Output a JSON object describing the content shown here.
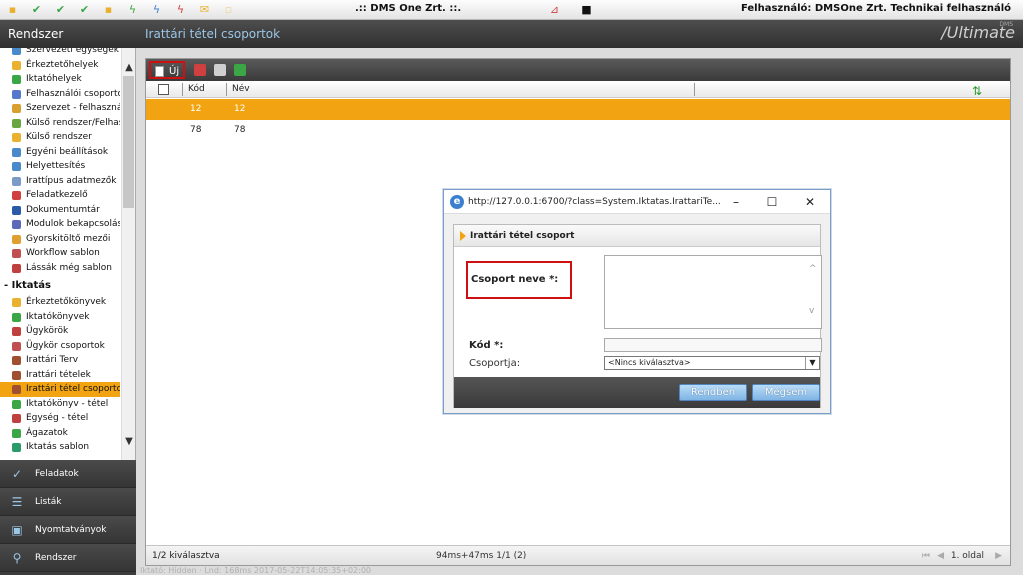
{
  "window": {
    "title": ".:: DMS One Zrt. ::.",
    "user": "Felhasználó: DMSOne Zrt. Technikai felhasználó"
  },
  "header": {
    "left": "Rendszer",
    "title": "Irattári tétel csoportok",
    "logo": "/Ultimate",
    "logo_small": "DMS"
  },
  "sidebar": {
    "items_top": [
      {
        "label": "Szervezeti egységek",
        "color": "#4a8acb"
      },
      {
        "label": "Érkeztetőhelyek",
        "color": "#e9b12f"
      },
      {
        "label": "Iktatóhelyek",
        "color": "#3aa645"
      },
      {
        "label": "Felhasználói csoportok",
        "color": "#5577cc"
      },
      {
        "label": "Szervezet - felhasználó",
        "color": "#d9a030"
      },
      {
        "label": "Külső rendszer/Felhasz",
        "color": "#6aa640"
      },
      {
        "label": "Külső rendszer",
        "color": "#e9b12f"
      },
      {
        "label": "Egyéni beállítások",
        "color": "#4a8acb"
      },
      {
        "label": "Helyettesítés",
        "color": "#4a8acb"
      },
      {
        "label": "Irattípus adatmezők",
        "color": "#7a9ac8"
      },
      {
        "label": "Feladatkezelő",
        "color": "#d04040"
      },
      {
        "label": "Dokumentumtár",
        "color": "#2a5aa8"
      },
      {
        "label": "Modulok bekapcsolása",
        "color": "#5a6ab8"
      },
      {
        "label": "Gyorskitöltő mezői",
        "color": "#e0a030"
      },
      {
        "label": "Workflow sablon",
        "color": "#c05050"
      },
      {
        "label": "Lássák még sablon",
        "color": "#c04040"
      }
    ],
    "section": "Iktatás",
    "items_bottom": [
      {
        "label": "Érkeztetőkönyvek",
        "color": "#e9b12f"
      },
      {
        "label": "Iktatókönyvek",
        "color": "#3aa645"
      },
      {
        "label": "Ügykörök",
        "color": "#c04040"
      },
      {
        "label": "Ügykör csoportok",
        "color": "#c05050"
      },
      {
        "label": "Irattári Terv",
        "color": "#a05030"
      },
      {
        "label": "Irattári tételek",
        "color": "#a05030"
      },
      {
        "label": "Irattári tétel csoportok",
        "color": "#a05030",
        "selected": true
      },
      {
        "label": "Iktatókönyv - tétel",
        "color": "#3aa645"
      },
      {
        "label": "Egység - tétel",
        "color": "#c04040"
      },
      {
        "label": "Ágazatok",
        "color": "#3aa645"
      },
      {
        "label": "Iktatás sablon",
        "color": "#2a9a6a"
      }
    ]
  },
  "bottomnav": [
    {
      "label": "Feladatok",
      "icon": "✓"
    },
    {
      "label": "Listák",
      "icon": "☰"
    },
    {
      "label": "Nyomtatványok",
      "icon": "▣"
    },
    {
      "label": "Rendszer",
      "icon": "⚲"
    }
  ],
  "toolbar": {
    "new_label": "Új"
  },
  "table": {
    "columns": [
      "Kód",
      "Név"
    ],
    "rows": [
      {
        "kod": "12",
        "nev": "12",
        "selected": true
      },
      {
        "kod": "78",
        "nev": "78",
        "selected": false
      }
    ]
  },
  "status": {
    "selected": "1/2 kiválasztva",
    "timing": "94ms+47ms 1/1 (2)",
    "page": "1. oldal"
  },
  "footer_ghost": "Iktató: Hidden · Lnd: 168ms   2017-05-22T14:05:35+02:00",
  "dialog": {
    "url": "http://127.0.0.1:6700/?class=System.Iktatas.IrattariTe...",
    "panel_title": "Irattári tétel csoport",
    "label_name": "Csoport neve *:",
    "label_code": "Kód *:",
    "label_group": "Csoportja:",
    "group_value": "<Nincs kiválasztva>",
    "ok_label": "Rendben",
    "cancel_label": "Mégsem"
  }
}
